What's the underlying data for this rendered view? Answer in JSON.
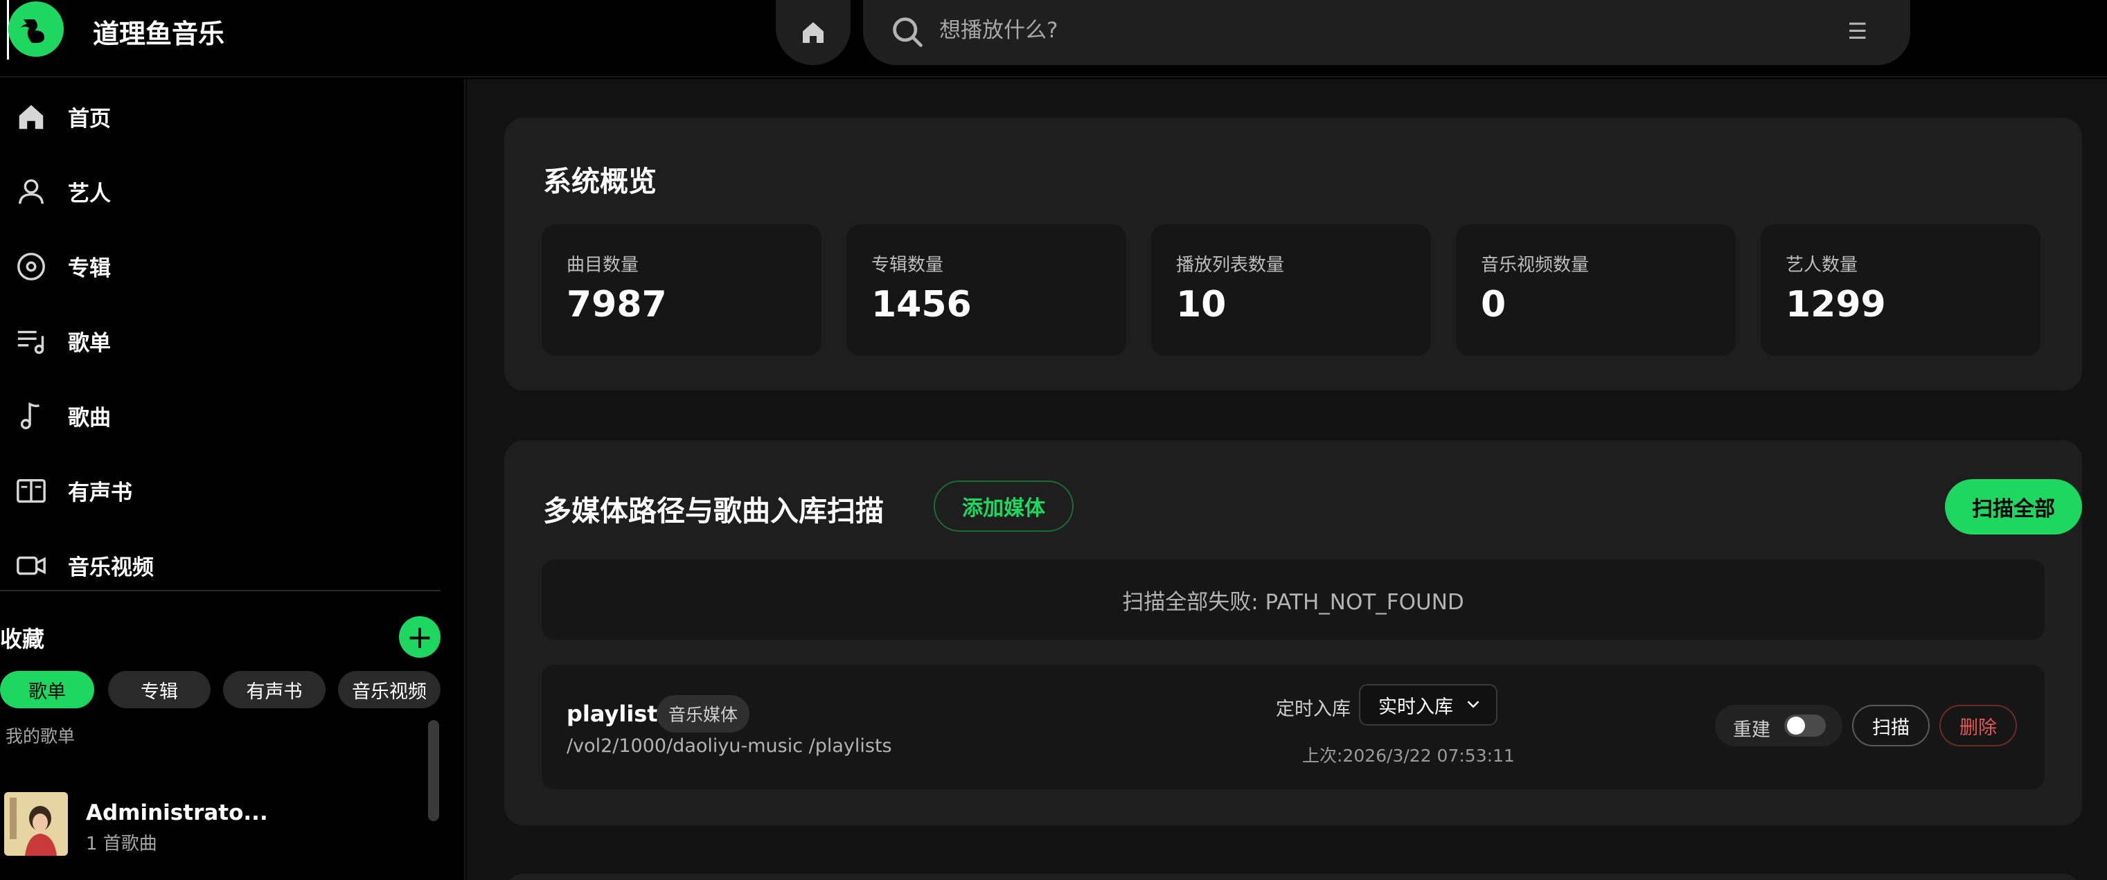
{
  "app": {
    "title": "道理鱼音乐"
  },
  "header": {
    "search_placeholder": "想播放什么?"
  },
  "sidebar": {
    "nav": [
      {
        "label": "首页",
        "icon": "home-icon"
      },
      {
        "label": "艺人",
        "icon": "person-icon"
      },
      {
        "label": "专辑",
        "icon": "disc-icon"
      },
      {
        "label": "歌单",
        "icon": "playlist-icon"
      },
      {
        "label": "歌曲",
        "icon": "music-note-icon"
      },
      {
        "label": "有声书",
        "icon": "book-icon"
      },
      {
        "label": "音乐视频",
        "icon": "video-icon"
      }
    ],
    "favorites_title": "收藏",
    "filters": [
      "歌单",
      "专辑",
      "有声书",
      "音乐视频"
    ],
    "active_filter": "歌单",
    "my_playlists_label": "我的歌单",
    "playlist": {
      "name": "Administrato...",
      "count": "1 首歌曲"
    }
  },
  "overview": {
    "title": "系统概览",
    "stats": [
      {
        "label": "曲目数量",
        "value": "7987"
      },
      {
        "label": "专辑数量",
        "value": "1456"
      },
      {
        "label": "播放列表数量",
        "value": "10"
      },
      {
        "label": "音乐视频数量",
        "value": "0"
      },
      {
        "label": "艺人数量",
        "value": "1299"
      }
    ]
  },
  "scan": {
    "title": "多媒体路径与歌曲入库扫描",
    "add_media_label": "添加媒体",
    "scan_all_label": "扫描全部",
    "error_message": "扫描全部失败: PATH_NOT_FOUND",
    "media": {
      "name": "playlists",
      "badge": "音乐媒体",
      "path": "/vol2/1000/daoliyu-music /playlists",
      "schedule_label": "定时入库",
      "schedule_value": "实时入库",
      "last_scan": "上次:2026/3/22 07:53:11",
      "rebuild_label": "重建",
      "rebuild_enabled": false,
      "scan_label": "扫描",
      "delete_label": "删除"
    }
  },
  "colors": {
    "accent": "#1ed760",
    "background": "#000000",
    "main_bg": "#121212",
    "card_bg": "#1e1e1e",
    "danger": "#e05a5a"
  }
}
